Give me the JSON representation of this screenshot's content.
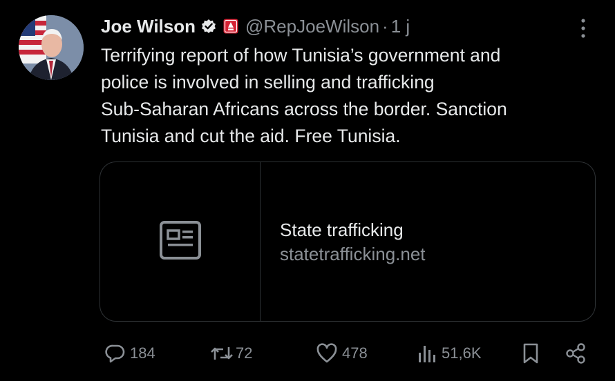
{
  "author": {
    "name": "Joe Wilson",
    "handle": "@RepJoeWilson",
    "separator": "·",
    "time": "1 j"
  },
  "tweet": {
    "lines": [
      "Terrifying report of how Tunisia’s government and",
      "police is involved in selling and trafficking",
      "Sub-Saharan Africans across the border. Sanction",
      "Tunisia and cut the aid. Free Tunisia."
    ]
  },
  "link_card": {
    "title": "State trafficking",
    "domain": "statetrafficking.net"
  },
  "metrics": {
    "replies": "184",
    "reposts": "72",
    "likes": "478",
    "views": "51,6K"
  },
  "colors": {
    "background": "#000000",
    "text": "#e7e9ea",
    "muted": "#8b9096",
    "border": "#2f3336",
    "verified": "#e7e9ea",
    "affiliation": "#d62234"
  },
  "icons": [
    "verified-badge-icon",
    "affiliation-badge-icon",
    "more-icon",
    "article-icon",
    "reply-icon",
    "repost-icon",
    "like-icon",
    "views-icon",
    "bookmark-icon",
    "share-icon"
  ]
}
